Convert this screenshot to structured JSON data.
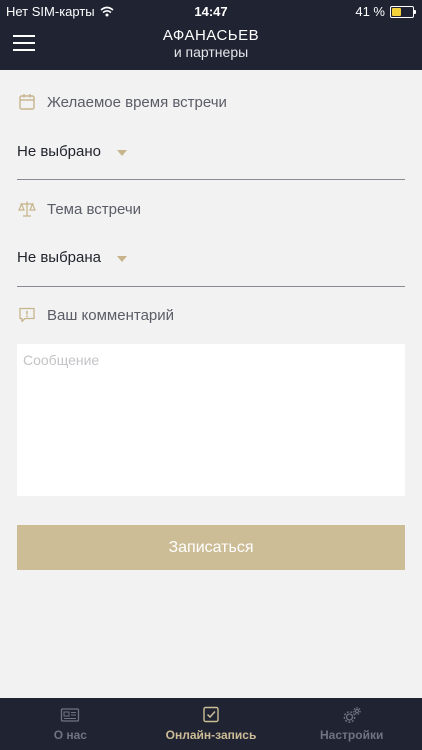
{
  "status": {
    "carrier": "Нет SIM-карты",
    "time": "14:47",
    "battery_text": "41 %",
    "battery_level": 0.41
  },
  "header": {
    "title_line1": "АФАНАСЬЕВ",
    "title_line2": "и партнеры"
  },
  "form": {
    "time_label": "Желаемое время встречи",
    "time_value": "Не выбрано",
    "topic_label": "Тема встречи",
    "topic_value": "Не выбрана",
    "comment_label": "Ваш комментарий",
    "comment_placeholder": "Сообщение",
    "submit_label": "Записаться"
  },
  "tabs": [
    {
      "label": "О нас",
      "icon": "newspaper-icon"
    },
    {
      "label": "Онлайн-запись",
      "icon": "checkbox-icon",
      "active": true
    },
    {
      "label": "Настройки",
      "icon": "gears-icon"
    }
  ],
  "colors": {
    "accent": "#cdbd96",
    "header_bg": "#1f2332",
    "background": "#f2f2f3"
  }
}
